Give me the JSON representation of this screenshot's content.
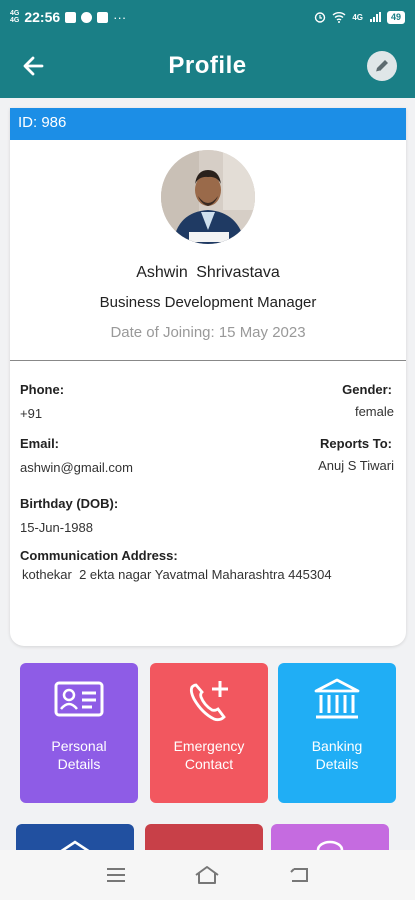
{
  "status_bar": {
    "network_top": "4G",
    "network_bottom": "4G",
    "time": "22:56",
    "overflow": "···",
    "wifi_label": "4G",
    "battery": "49"
  },
  "app_bar": {
    "title": "Profile",
    "back_icon": "arrow-left-icon",
    "edit_icon": "pencil-icon"
  },
  "profile": {
    "id_label": "ID: 986",
    "name": "Ashwin  Shrivastava",
    "designation": "Business Development Manager",
    "date_of_joining": "Date of Joining: 15 May 2023"
  },
  "details": {
    "phone_label": "Phone:",
    "phone_value": "+91",
    "gender_label": "Gender:",
    "gender_value": "female",
    "email_label": "Email:",
    "email_value": "ashwin@gmail.com",
    "reports_to_label": "Reports To:",
    "reports_to_value": "Anuj S Tiwari",
    "birthday_label": "Birthday (DOB):",
    "birthday_value": "15-Jun-1988",
    "address_label": "Communication Address:",
    "address_value": "kothekar  2 ekta nagar Yavatmal Maharashtra 445304"
  },
  "tiles": [
    {
      "label_line1": "Personal",
      "label_line2": "Details",
      "icon": "id-card-icon",
      "color": "#8e5ce6"
    },
    {
      "label_line1": "Emergency",
      "label_line2": "Contact",
      "icon": "phone-plus-icon",
      "color": "#f2575f"
    },
    {
      "label_line1": "Banking",
      "label_line2": "Details",
      "icon": "bank-icon",
      "color": "#20aef5"
    }
  ],
  "tiles_partial": [
    {
      "color": "#2150a0"
    },
    {
      "color": "#c84048"
    },
    {
      "color": "#c56be0"
    }
  ],
  "nav_bar": {
    "recent_icon": "menu-icon",
    "home_icon": "home-icon",
    "back_icon": "back-icon"
  },
  "colors": {
    "primary": "#1a7f86",
    "id_strip": "#1c8ee6"
  }
}
